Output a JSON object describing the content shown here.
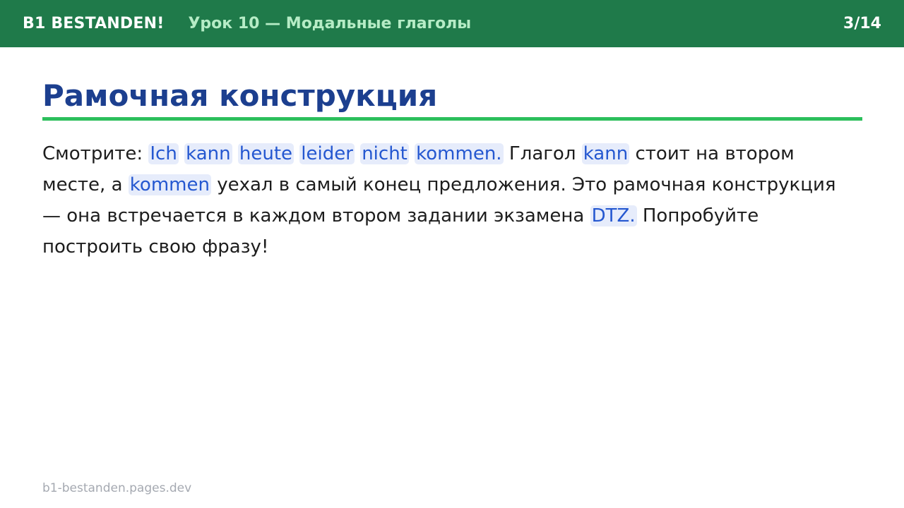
{
  "header": {
    "brand": "B1 BESTANDEN!",
    "lesson": "Урок 10 — Модальные глаголы",
    "counter": "3/14"
  },
  "slide": {
    "title": "Рамочная конструкция",
    "paragraph": {
      "t1": "Смотрите: ",
      "ex1_w1": "Ich",
      "ex1_w2": "kann",
      "ex1_w3": "heute",
      "ex1_w4": "leider",
      "ex1_w5": "nicht",
      "ex1_w6": "kommen.",
      "t2": " Глагол ",
      "kw_kann": "kann",
      "t3": " стоит на втором месте, а ",
      "kw_kommen": "kommen",
      "t4": " уехал в самый конец предложения. Это рамочная конструкция — она встречается в каждом втором задании экзамена ",
      "kw_dtz": "DTZ.",
      "t5": " Попробуйте построить свою фразу!"
    }
  },
  "footer": {
    "url": "b1-bestanden.pages.dev"
  },
  "colors": {
    "header_bg": "#1f7a4a",
    "lesson_text": "#b6ecc6",
    "title": "#1c3f8f",
    "rule": "#2cbf5c",
    "highlight_text": "#2457d0",
    "highlight_bg": "#e6ecfb"
  }
}
